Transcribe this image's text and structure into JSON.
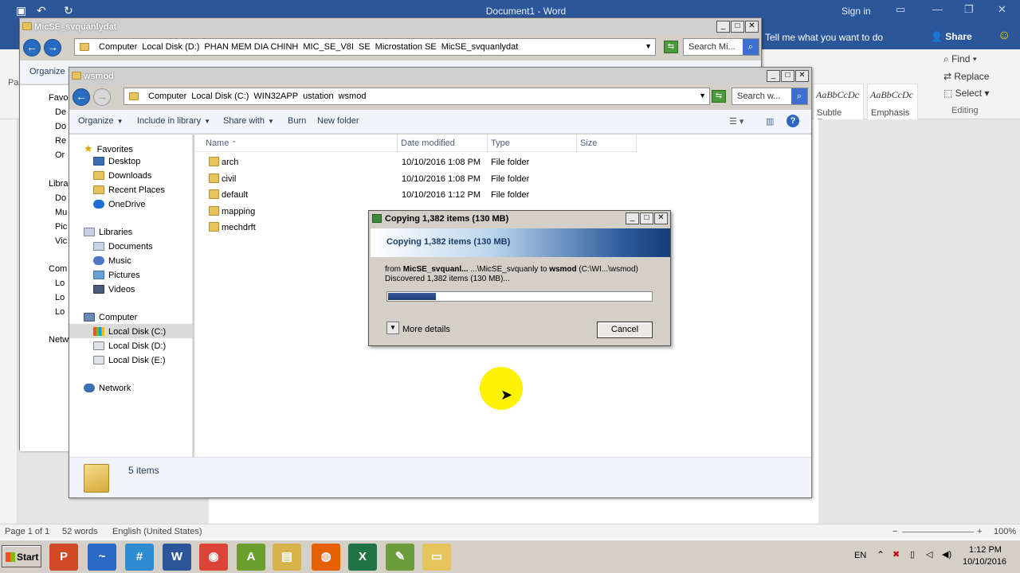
{
  "word": {
    "title": "Document1 - Word",
    "signin": "Sign in",
    "tellme": "Tell me what you want to do",
    "share": "Share",
    "styles": [
      {
        "sample": "AaBbCcDc",
        "name": "Subtle Em..."
      },
      {
        "sample": "AaBbCcDc",
        "name": "Emphasis"
      }
    ],
    "editing": {
      "find": "Find",
      "replace": "Replace",
      "select": "Select",
      "group_label": "Editing"
    },
    "left_tab": "Pa",
    "status": {
      "page": "Page 1 of 1",
      "words": "52 words",
      "language": "English (United States)",
      "zoom": "100%"
    }
  },
  "back_window": {
    "title": "MicSE_svquanlydat",
    "crumbs": [
      "Computer",
      "Local Disk (D:)",
      "PHAN MEM DIA CHINH",
      "MIC_SE_V8I",
      "SE",
      "Microstation SE",
      "MicSE_svquanlydat"
    ],
    "search_placeholder": "Search Mi...",
    "organize": "Organize",
    "nav_partial": [
      "Favo",
      "De",
      "Do",
      "Re",
      "Or",
      "Libra",
      "Do",
      "Mu",
      "Pic",
      "Vic",
      "Com",
      "Lo",
      "Lo",
      "Lo",
      "Netw"
    ]
  },
  "front_window": {
    "title": "wsmod",
    "crumbs": [
      "Computer",
      "Local Disk (C:)",
      "WIN32APP",
      "ustation",
      "wsmod"
    ],
    "search_placeholder": "Search w...",
    "toolbar": {
      "organize": "Organize",
      "include": "Include in library",
      "share": "Share with",
      "burn": "Burn",
      "new_folder": "New folder"
    },
    "nav": {
      "favorites": "Favorites",
      "desktop": "Desktop",
      "downloads": "Downloads",
      "recent": "Recent Places",
      "onedrive": "OneDrive",
      "libraries": "Libraries",
      "documents": "Documents",
      "music": "Music",
      "pictures": "Pictures",
      "videos": "Videos",
      "computer": "Computer",
      "disk_c": "Local Disk (C:)",
      "disk_d": "Local Disk (D:)",
      "disk_e": "Local Disk  (E:)",
      "network": "Network"
    },
    "columns": {
      "name": "Name",
      "date": "Date modified",
      "type": "Type",
      "size": "Size"
    },
    "files": [
      {
        "name": "arch",
        "date": "10/10/2016 1:08 PM",
        "type": "File folder"
      },
      {
        "name": "civil",
        "date": "10/10/2016 1:08 PM",
        "type": "File folder"
      },
      {
        "name": "default",
        "date": "10/10/2016 1:12 PM",
        "type": "File folder"
      },
      {
        "name": "mapping",
        "date": "",
        "type": ""
      },
      {
        "name": "mechdrft",
        "date": "",
        "type": ""
      }
    ],
    "item_count": "5 items"
  },
  "copy_dialog": {
    "title": "Copying 1,382 items (130 MB)",
    "heading": "Copying 1,382 items (130 MB)",
    "from_label": "from",
    "from_bold": "MicSE_svquanl...",
    "from_rest": " ...\\MicSE_svquanly to ",
    "to_bold": "wsmod",
    "to_rest": " (C:\\WI...\\wsmod)",
    "discovered": "Discovered 1,382 items (130 MB)...",
    "progress_percent": 18,
    "more_details": "More details",
    "cancel": "Cancel"
  },
  "taskbar": {
    "start": "Start",
    "apps": [
      {
        "name": "powerpoint-icon",
        "glyph": "P",
        "color": "#d24726"
      },
      {
        "name": "app-icon",
        "glyph": "~",
        "color": "#2b6ac4"
      },
      {
        "name": "calculator-icon",
        "glyph": "#",
        "color": "#2e8bd0"
      },
      {
        "name": "word-icon",
        "glyph": "W",
        "color": "#2b579a"
      },
      {
        "name": "chrome-icon",
        "glyph": "◉",
        "color": "#db4437"
      },
      {
        "name": "spellcheck-icon",
        "glyph": "A",
        "color": "#6a9f2e"
      },
      {
        "name": "explorer-icon",
        "glyph": "▤",
        "color": "#d8b24c"
      },
      {
        "name": "firefox-icon",
        "glyph": "◍",
        "color": "#e66000"
      },
      {
        "name": "excel-icon",
        "glyph": "X",
        "color": "#217346"
      },
      {
        "name": "tool-icon",
        "glyph": "✎",
        "color": "#6b9d3a"
      },
      {
        "name": "folder-icon",
        "glyph": "▭",
        "color": "#e6c35c"
      }
    ],
    "lang": "EN",
    "time": "1:12 PM",
    "date": "10/10/2016"
  },
  "colors": {
    "word_blue": "#2b579a",
    "progress": "#1b3a78",
    "highlight": "#fff200"
  }
}
